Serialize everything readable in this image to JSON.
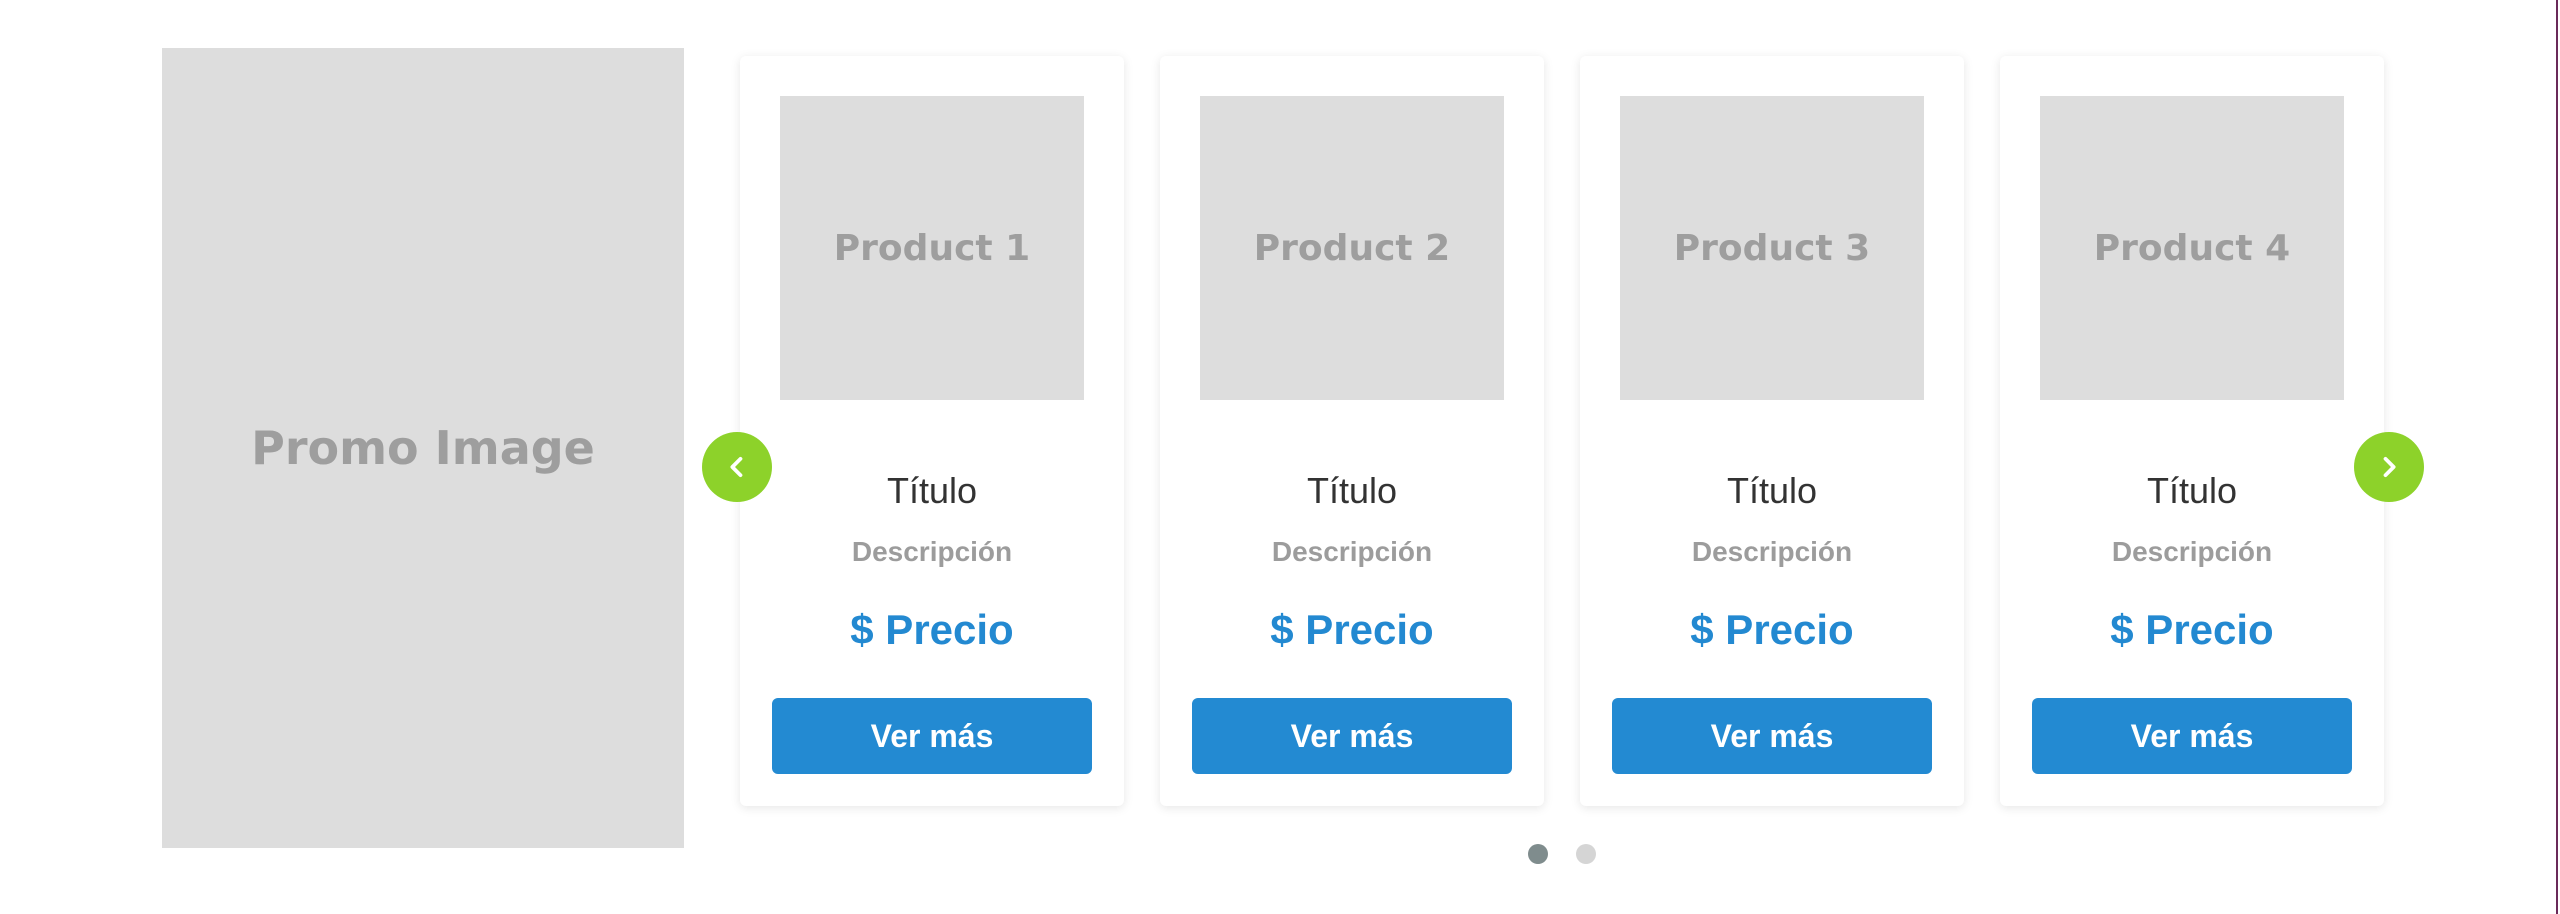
{
  "promo": {
    "label": "Promo Image"
  },
  "products": [
    {
      "image_label": "Product 1",
      "title": "Título",
      "description": "Descripción",
      "price": "$ Precio",
      "button": "Ver más"
    },
    {
      "image_label": "Product 2",
      "title": "Título",
      "description": "Descripción",
      "price": "$ Precio",
      "button": "Ver más"
    },
    {
      "image_label": "Product 3",
      "title": "Título",
      "description": "Descripción",
      "price": "$ Precio",
      "button": "Ver más"
    },
    {
      "image_label": "Product 4",
      "title": "Título",
      "description": "Descripción",
      "price": "$ Precio",
      "button": "Ver más"
    }
  ],
  "carousel": {
    "prev_icon": "chevron-left-icon",
    "next_icon": "chevron-right-icon",
    "active_page": 1,
    "page_count": 2
  },
  "colors": {
    "accent_green": "#8dd22a",
    "primary_blue": "#238ad2",
    "dot_active": "#7f8c8d",
    "dot_inactive": "#d5d5d5"
  }
}
